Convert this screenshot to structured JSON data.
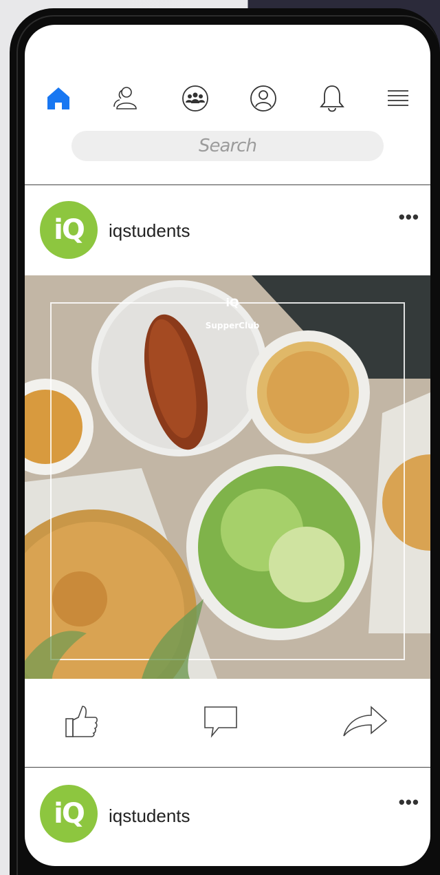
{
  "nav": {
    "icons": [
      "home-icon",
      "friends-icon",
      "groups-icon",
      "profile-icon",
      "notifications-icon",
      "menu-icon"
    ],
    "active_color": "#1877f2"
  },
  "search": {
    "placeholder": "Search"
  },
  "posts": [
    {
      "username": "iqstudents",
      "avatar_text": "iQ",
      "more": "•••"
    },
    {
      "username": "iqstudents",
      "avatar_text": "iQ",
      "more": "•••"
    }
  ],
  "photo": {
    "watermark_brand": "iQ",
    "watermark_text": "SupperClub"
  },
  "actions": [
    "like-icon",
    "comment-icon",
    "share-icon"
  ],
  "colors": {
    "brand_green": "#8dc63f"
  }
}
